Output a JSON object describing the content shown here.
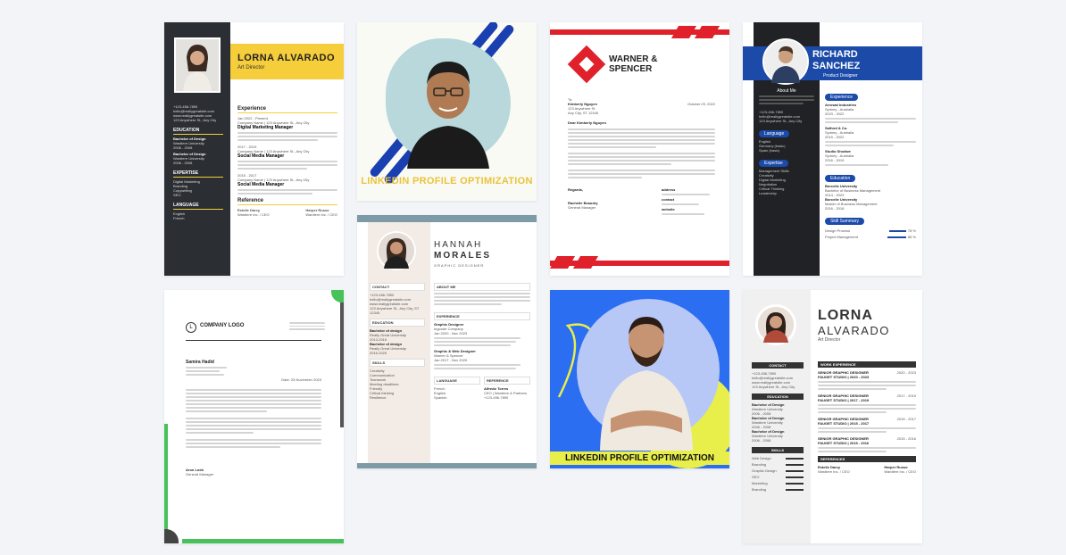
{
  "cards": {
    "c1": {
      "name": "LORNA ALVARADO",
      "role": "Art Director",
      "contact": [
        "+123-456-7890",
        "hello@reallygreatsite.com",
        "www.reallygreatsite.com",
        "123 Anywhere St., Any City"
      ],
      "education_heading": "EDUCATION",
      "education": [
        {
          "degree": "Bachelor of Design",
          "school": "Wardiere University",
          "years": "2006 - 2008"
        },
        {
          "degree": "Bachelor of Design",
          "school": "Wardiere University",
          "years": "2006 - 2008"
        }
      ],
      "expertise_heading": "EXPERTISE",
      "expertise": [
        "Digital Marketing",
        "Branding",
        "Copywriting",
        "SEO"
      ],
      "language_heading": "LANGUAGE",
      "languages": [
        "English",
        "French"
      ],
      "experience_heading": "Experience",
      "jobs": [
        {
          "years": "Jan 2022 - Present",
          "company": "Company Name | 123 Anywhere St., Any City",
          "title": "Digital Marketing Manager"
        },
        {
          "years": "2017 - 2019",
          "company": "Company Name | 123 Anywhere St., Any City",
          "title": "Social Media Manager"
        },
        {
          "years": "2015 - 2017",
          "company": "Company Name | 123 Anywhere St., Any City",
          "title": "Social Media Manager"
        }
      ],
      "reference_heading": "Reference",
      "refs": [
        {
          "name": "Estelle Darcy",
          "org": "Wardiere Inc. / CEO"
        },
        {
          "name": "Harper Russo",
          "org": "Wardiere Inc. / CEO"
        }
      ]
    },
    "c2": {
      "caption": "LINKEDIN PROFILE OPTIMIZATION"
    },
    "c3": {
      "brand_line1": "WARNER &",
      "brand_line2": "SPENCER",
      "to_label": "To:",
      "recipient": "Kimberly Nguyen",
      "date": "October 29, 2022",
      "address1": "123 Anywhere St.",
      "address2": "Any City, ST 12345",
      "salutation": "Dear Kimberly Nguyen",
      "closing": "Regards,",
      "signer": "Rachelle Beaudry",
      "signer_title": "General Manager",
      "contact_labels": [
        "address",
        "contact",
        "website"
      ]
    },
    "c4": {
      "name1": "RICHARD",
      "name2": "SANCHEZ",
      "role": "Product Designer",
      "about_heading": "About Me",
      "experience_pill": "Experience",
      "jobs": [
        {
          "company": "Arrowai Industries",
          "place": "Sydney - Australia",
          "years": "2023 - 2022"
        },
        {
          "company": "Salford & Co.",
          "place": "Sydney - Australia",
          "years": "2019 - 2022"
        },
        {
          "company": "Studio Shodwe",
          "place": "Sydney - Australia",
          "years": "2016 - 2019"
        }
      ],
      "contact": [
        "+123-456-7890",
        "hello@reallygreatsite.com",
        "123 Anywhere St., Any City"
      ],
      "language_pill": "Language",
      "languages": [
        "English",
        "Germany (basic)",
        "Spain (basic)"
      ],
      "expertise_pill": "Expertise",
      "expertise": [
        "Management Skills",
        "Creativity",
        "Digital Marketing",
        "Negotiation",
        "Critical Thinking",
        "Leadership"
      ],
      "education_pill": "Education",
      "education": [
        {
          "school": "Borcelle University",
          "degree": "Bachelor of Business Management",
          "years": "2014 - 2023"
        },
        {
          "school": "Borcelle University",
          "degree": "Master of Business Management",
          "years": "2016 - 2018"
        }
      ],
      "skills_pill": "Skill Summary",
      "skills": [
        {
          "name": "Design Process",
          "pct": "78 %",
          "level": 0.78
        },
        {
          "name": "Project Management",
          "pct": "85 %",
          "level": 0.85
        }
      ]
    },
    "c5": {
      "logo_letter": "L",
      "logo_text": "COMPANY LOGO",
      "sender": "Samira Hadid",
      "signer": "Aron Loeb",
      "signer_title": "General Manager",
      "date": "Date: 25 November 2023"
    },
    "c6": {
      "name1": "HANNAH",
      "name2": "MORALES",
      "role": "GRAPHIC DESIGNER",
      "contact_heading": "CONTACT",
      "contact": [
        "+123-456-7890",
        "hello@reallygreatsite.com",
        "www.reallygreatsite.com",
        "123 Anywhere St., Any City, ST 12345"
      ],
      "about_heading": "ABOUT ME",
      "education_heading": "EDUCATION",
      "education": [
        {
          "degree": "Bachelor of design",
          "school": "Really Great University",
          "years": "2013-2016"
        },
        {
          "degree": "Bachelor of design",
          "school": "Really Great University",
          "years": "2016-2020"
        }
      ],
      "experience_heading": "EXPERIENCE",
      "jobs": [
        {
          "title": "Graphic Designer",
          "company": "Ingoude Company",
          "years": "Jan 2020 - Nov 2023"
        },
        {
          "title": "Graphic & Web Designer",
          "company": "Warner & Spencer",
          "years": "Jan 2017 - Nov 2020"
        }
      ],
      "skills_heading": "SKILLS",
      "skills": [
        "Creativity",
        "Communication",
        "Teamwork",
        "Meeting deadlines",
        "Friendly",
        "Critical thinking",
        "Resilience"
      ],
      "language_heading": "LANGUAGE",
      "languages": [
        "French",
        "English",
        "Spanish"
      ],
      "reference_heading": "REFERENCE",
      "reference_name": "Alfredo Torres",
      "reference_org": "CEO | Wardiere & Partners",
      "reference_phone": "+123-456-7890"
    },
    "c7": {
      "caption": "LINKEDIN PROFILE OPTIMIZATION"
    },
    "c8": {
      "name1": "LORNA",
      "name2": "ALVARADO",
      "role": "Art Director",
      "contact_heading": "CONTACT",
      "contact": [
        "+123-456-7890",
        "hello@reallygreatsite.com",
        "www.reallygreatsite.com",
        "123 Anywhere St., Any City"
      ],
      "education_heading": "EDUCATION",
      "education": [
        {
          "degree": "Bachelor of Design",
          "school": "Wardiere University",
          "years": "2006 - 2008"
        },
        {
          "degree": "Bachelor of Design",
          "school": "Wardiere University",
          "years": "2006 - 2008"
        },
        {
          "degree": "Bachelor of Design",
          "school": "Wardiere University",
          "years": "2006 - 2008"
        }
      ],
      "skills_heading": "SKILLS",
      "skills": [
        "Web Design",
        "Branding",
        "Graphic Design",
        "SEO",
        "Marketing",
        "Branding"
      ],
      "work_heading": "WORK EXPERIENCE",
      "jobs": [
        {
          "title": "SENIOR GRAPHIC DESIGNER",
          "company": "FAUGET STUDIO | 2020 - 2023",
          "years": "2020 - 2023"
        },
        {
          "title": "SENIOR GRAPHIC DESIGNER",
          "company": "FAUGET STUDIO | 2017 - 2019",
          "years": "2017 - 2019"
        },
        {
          "title": "SENIOR GRAPHIC DESIGNER",
          "company": "FAUGET STUDIO | 2015 - 2017",
          "years": "2015 - 2017"
        },
        {
          "title": "SENIOR GRAPHIC DESIGNER",
          "company": "FAUGET STUDIO | 2015 - 2016",
          "years": "2015 - 2016"
        }
      ],
      "references_heading": "REFERENCES",
      "refs": [
        {
          "name": "Estelle Darcy",
          "org": "Wardiere Inc. / CEO"
        },
        {
          "name": "Harper Russo",
          "org": "Wardiere Inc. / CEO"
        }
      ]
    }
  }
}
